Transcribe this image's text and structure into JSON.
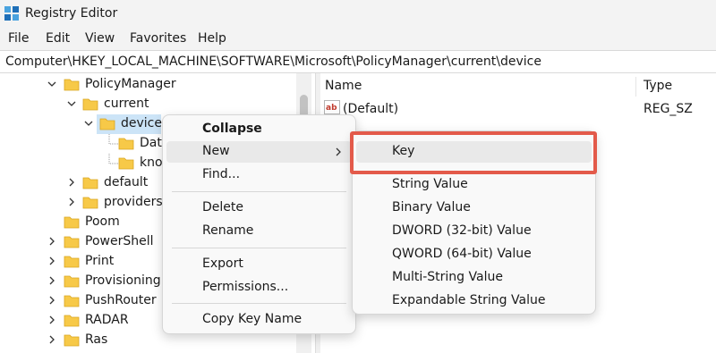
{
  "window": {
    "title": "Registry Editor",
    "accent": "#0078d4"
  },
  "menubar": {
    "items": [
      "File",
      "Edit",
      "View",
      "Favorites",
      "Help"
    ]
  },
  "address": {
    "path": "Computer\\HKEY_LOCAL_MACHINE\\SOFTWARE\\Microsoft\\PolicyManager\\current\\device"
  },
  "tree": {
    "items": [
      {
        "label": "PolicyManager",
        "expanded": true
      },
      {
        "label": "current",
        "expanded": true
      },
      {
        "label": "device",
        "expanded": true,
        "selected": true
      },
      {
        "label": "Dat"
      },
      {
        "label": "kno"
      },
      {
        "label": "default",
        "expanded": false
      },
      {
        "label": "providers",
        "expanded": false
      },
      {
        "label": "Poom"
      },
      {
        "label": "PowerShell",
        "expanded": false
      },
      {
        "label": "Print",
        "expanded": false
      },
      {
        "label": "Provisioning",
        "expanded": false
      },
      {
        "label": "PushRouter",
        "expanded": false
      },
      {
        "label": "RADAR",
        "expanded": false
      },
      {
        "label": "Ras",
        "expanded": false
      }
    ]
  },
  "values_pane": {
    "columns": {
      "name": "Name",
      "type": "Type"
    },
    "rows": [
      {
        "name": "(Default)",
        "type": "REG_SZ",
        "icon": "string-value-icon"
      }
    ]
  },
  "context_menu": {
    "collapse": "Collapse",
    "new": "New",
    "find": "Find...",
    "delete": "Delete",
    "rename": "Rename",
    "export": "Export",
    "permissions": "Permissions...",
    "copy_key_name": "Copy Key Name"
  },
  "submenu": {
    "key": "Key",
    "string_value": "String Value",
    "binary_value": "Binary Value",
    "dword_value": "DWORD (32-bit) Value",
    "qword_value": "QWORD (64-bit) Value",
    "multi_string_value": "Multi-String Value",
    "expandable_string_value": "Expandable String Value"
  },
  "colors": {
    "highlight_border": "#e35a4a",
    "selection": "#cce4f7",
    "folder": "#f7c948"
  }
}
